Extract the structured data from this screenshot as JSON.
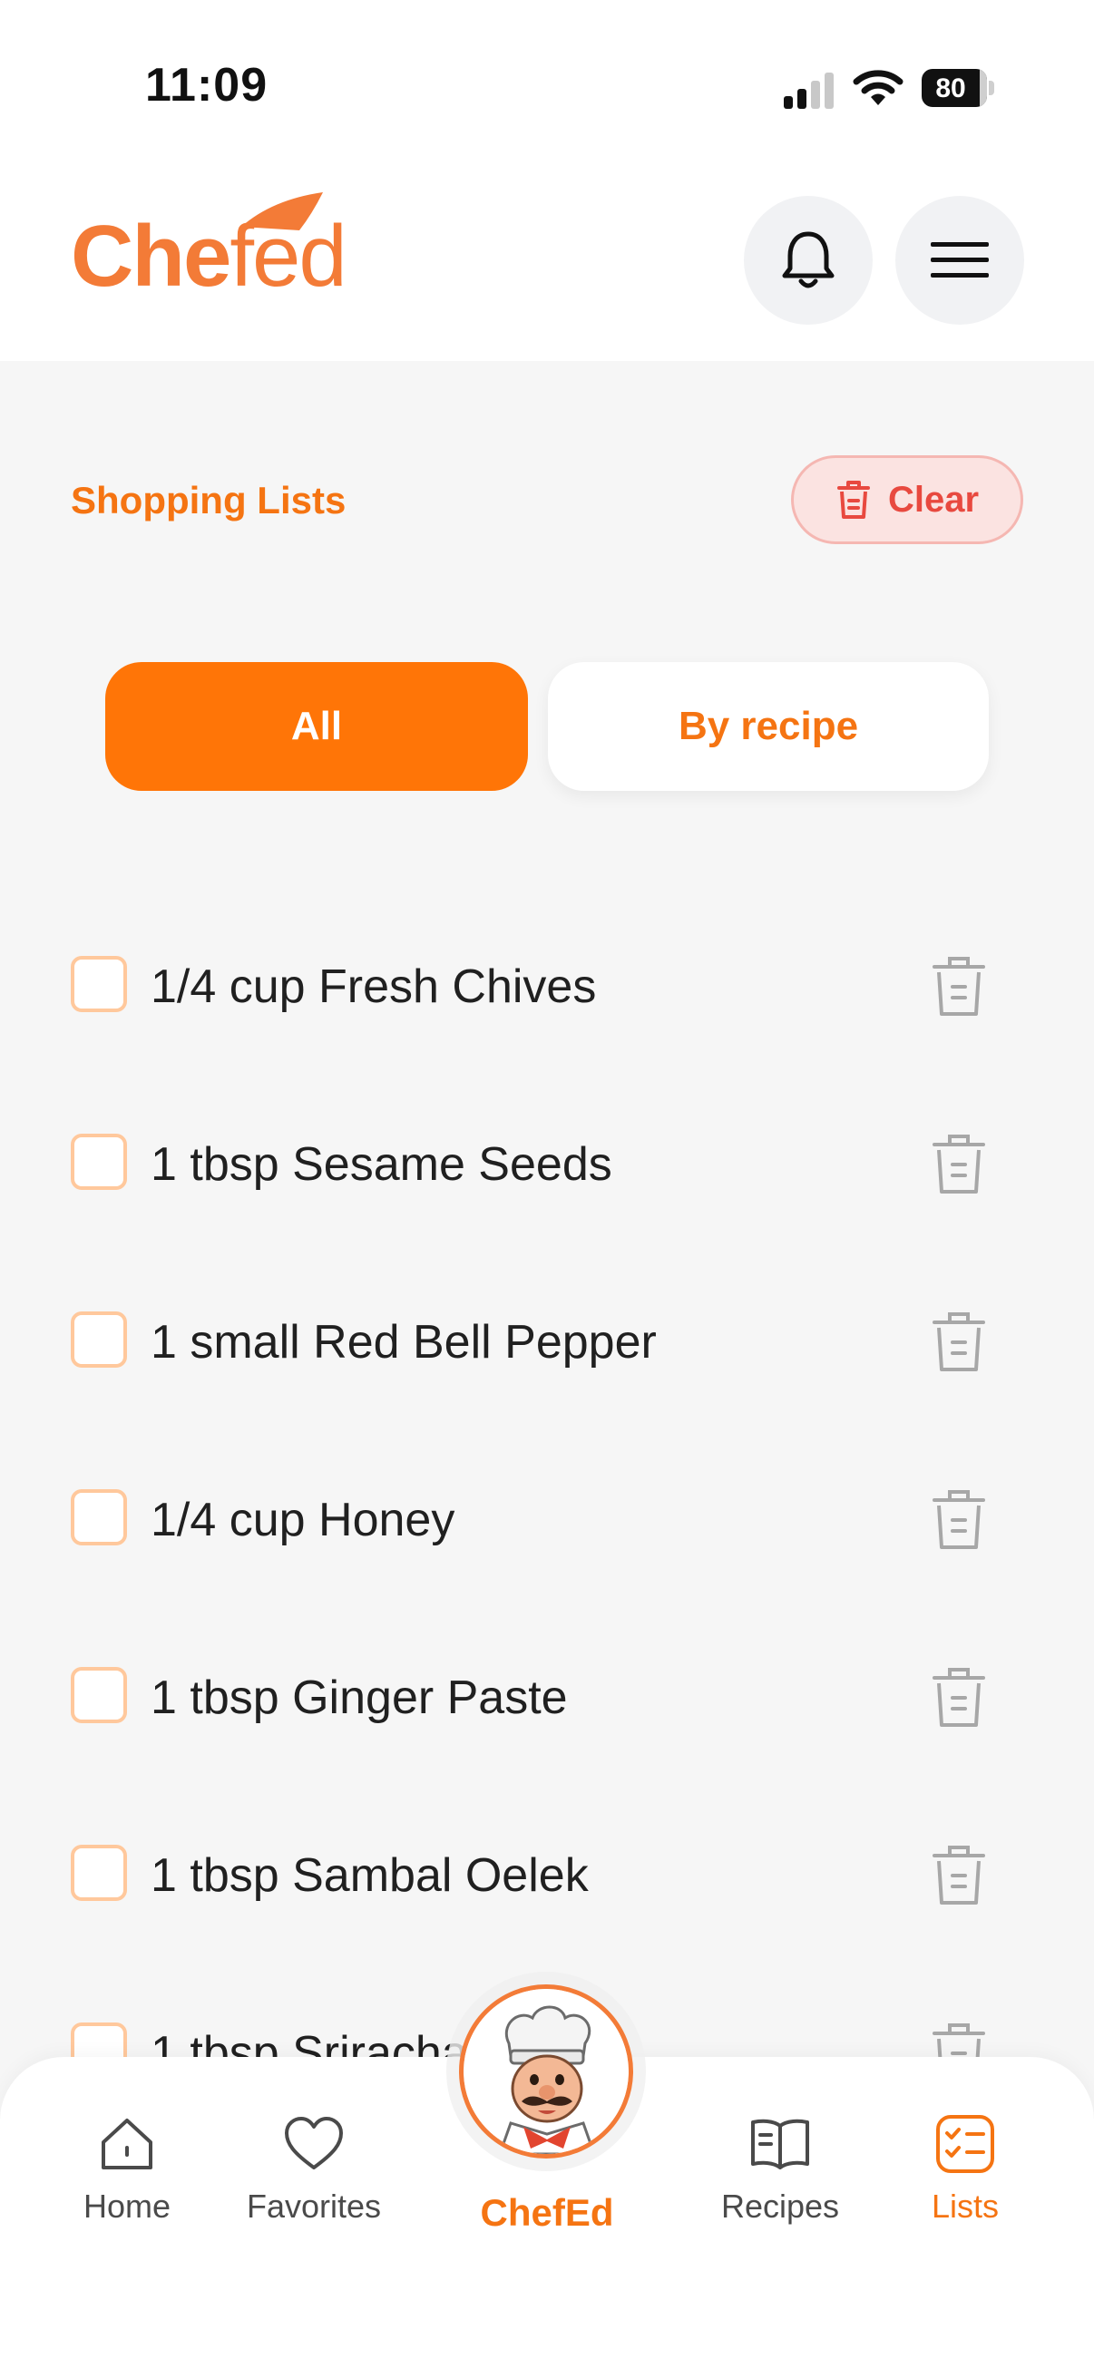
{
  "status_bar": {
    "time": "11:09",
    "battery": "80"
  },
  "header": {
    "logo_text_bold": "Che",
    "logo_text_light": "fed"
  },
  "section": {
    "title": "Shopping Lists",
    "clear_label": "Clear"
  },
  "tabs": [
    {
      "label": "All",
      "active": true
    },
    {
      "label": "By recipe",
      "active": false
    }
  ],
  "items": [
    {
      "text": "1/4 cup Fresh Chives",
      "checked": false
    },
    {
      "text": "1 tbsp Sesame Seeds",
      "checked": false
    },
    {
      "text": "1 small Red Bell Pepper",
      "checked": false
    },
    {
      "text": "1/4 cup Honey",
      "checked": false
    },
    {
      "text": "1 tbsp Ginger Paste",
      "checked": false
    },
    {
      "text": "1 tbsp Sambal Oelek",
      "checked": false
    },
    {
      "text": "1 tbsp Sriracha",
      "checked": false
    }
  ],
  "nav": {
    "home": "Home",
    "favorites": "Favorites",
    "chefed": "ChefEd",
    "recipes": "Recipes",
    "lists": "Lists"
  },
  "colors": {
    "accent": "#ff7507",
    "accent_text": "#f57412",
    "clear_bg": "#fbe3e1",
    "clear_text": "#e8493f",
    "checkbox_border": "#ffc89c"
  },
  "icons": {
    "bell": "bell-icon",
    "menu": "hamburger-menu-icon",
    "clear": "trash-icon",
    "home": "home-icon",
    "favorites": "heart-icon",
    "recipes": "book-icon",
    "lists": "checklist-icon"
  }
}
